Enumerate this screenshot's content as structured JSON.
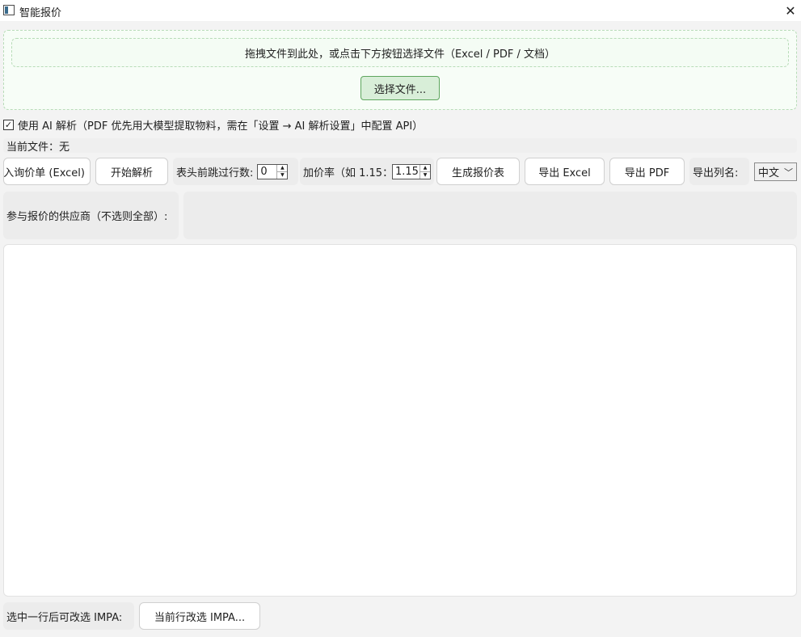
{
  "window": {
    "title": "智能报价",
    "close_glyph": "✕",
    "icon": "app-window-icon"
  },
  "dropzone": {
    "hint": "拖拽文件到此处，或点击下方按钮选择文件（Excel / PDF / 文档）",
    "choose_label": "选择文件..."
  },
  "ai_option": {
    "checked": true,
    "check_glyph": "✓",
    "label": "使用 AI 解析（PDF 优先用大模型提取物料，需在「设置 → AI 解析设置」中配置 API）"
  },
  "current_file": {
    "text": "当前文件：无"
  },
  "toolbar": {
    "import_label": "导入询价单 (Excel)",
    "parse_label": "开始解析",
    "skip_rows_label": "表头前跳过行数:",
    "skip_rows_value": "0",
    "markup_label": "加价率（如 1.15：",
    "markup_value": "1.15",
    "generate_label": "生成报价表",
    "export_excel_label": "导出 Excel",
    "export_pdf_label": "导出 PDF",
    "export_cols_label": "导出列名:",
    "export_cols_value": "中文"
  },
  "suppliers": {
    "label": "参与报价的供应商（不选则全部）:"
  },
  "impa": {
    "label": "选中一行后可改选 IMPA:",
    "button_label": "当前行改选 IMPA..."
  },
  "colors": {
    "dropzone_border": "#b8dcb8",
    "dropzone_bg": "#f7fdf7",
    "choose_btn_bg": "#d8eed8",
    "choose_btn_border": "#5ea65e",
    "window_bg": "#f3f3f3"
  }
}
